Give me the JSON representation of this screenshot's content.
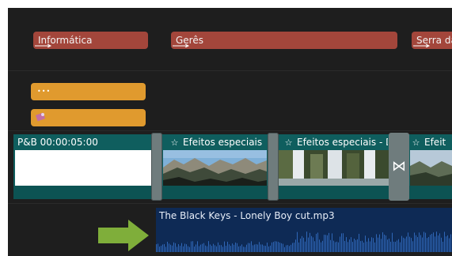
{
  "title_track": {
    "clips": [
      {
        "label": "Informática"
      },
      {
        "label": "Gerês"
      },
      {
        "label": "Serra da"
      }
    ]
  },
  "overlay_track": {
    "clips": [
      {
        "icon": "dots-icon"
      },
      {
        "icon": "image-sticker-icon"
      }
    ]
  },
  "video_track": {
    "clips": [
      {
        "label": "P&B  00:00:05:00"
      },
      {
        "label": "Efeitos especiais"
      },
      {
        "label": "Efeitos especiais - D"
      },
      {
        "label": "Efeit"
      }
    ],
    "transition_icon": "bowtie-transition-icon"
  },
  "audio_track": {
    "title": "The Black Keys - Lonely Boy cut.mp3"
  },
  "colors": {
    "background": "#1e1e1e",
    "title_clip": "#a3463b",
    "overlay_clip": "#e09a2e",
    "video_track": "#0f5e5e",
    "audio_track": "#0e2a55",
    "pointer_arrow": "#7fae3a"
  }
}
